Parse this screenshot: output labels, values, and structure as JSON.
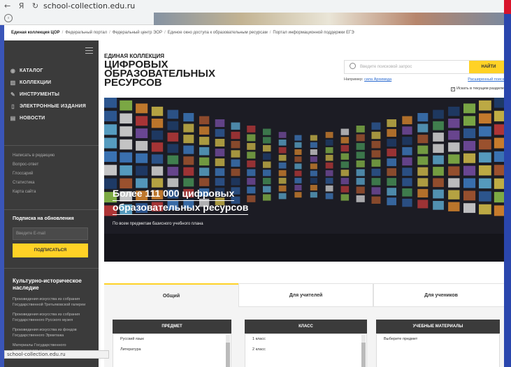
{
  "browser": {
    "url": "school-collection.edu.ru",
    "status_url": "school-collection.edu.ru"
  },
  "breadcrumb": [
    "Единая коллекция ЦОР",
    "Федеральный портал",
    "Федеральный центр ЭОР",
    "Единое окно доступа к образовательным ресурсам",
    "Портал информационной поддержки ЕГЭ"
  ],
  "sidebar": {
    "menu": [
      {
        "label": "КАТАЛОГ",
        "icon": "catalog-icon"
      },
      {
        "label": "КОЛЛЕКЦИИ",
        "icon": "collections-icon"
      },
      {
        "label": "ИНСТРУМЕНТЫ",
        "icon": "tools-icon"
      },
      {
        "label": "ЭЛЕКТРОННЫЕ ИЗДАНИЯ",
        "icon": "tablet-icon"
      },
      {
        "label": "НОВОСТИ",
        "icon": "news-icon"
      }
    ],
    "links": [
      "Написать в редакцию",
      "Вопрос-ответ",
      "Глоссарий",
      "Статистика",
      "Карта сайта"
    ],
    "subscribe": {
      "title": "Подписка на обновления",
      "email_placeholder": "Введите E-mail",
      "button": "ПОДПИСАТЬСЯ"
    },
    "heritage": {
      "title": "Культурно-историческое наследие",
      "items": [
        "Произведения искусства из собрания Государственной Третьяковской галереи",
        "Произведения искусства из собрания Государственного Русского музея",
        "Произведения искусства из фондов Государственного Эрмитажа",
        "Материалы Государственного исторического музея"
      ]
    }
  },
  "header": {
    "logo_small": "ЕДИНАЯ КОЛЛЕКЦИЯ",
    "logo_big": "ЦИФРОВЫХ ОБРАЗОВАТЕЛЬНЫХ РЕСУРСОВ",
    "search_placeholder": "Введите поисковой запрос",
    "search_button": "НАЙТИ",
    "example_prefix": "Например:",
    "example_link": "сила Архимеда",
    "advanced_search": "Расширенный поиск",
    "search_in_section": "Искать в текущем разделе"
  },
  "hero": {
    "title_line1": "Более 111 000 цифровых",
    "title_line2": "образовательных ресурсов",
    "subtitle": "По всем предметам базисного учебного плана"
  },
  "tabs": [
    "Общий",
    "Для учителей",
    "Для учеников"
  ],
  "filters": {
    "subject": {
      "header": "ПРЕДМЕТ",
      "options": [
        "Русский язык",
        "Литература"
      ]
    },
    "grade": {
      "header": "КЛАСС",
      "options": [
        "1 класс",
        "2 класс"
      ]
    },
    "materials": {
      "header": "УЧЕБНЫЕ МАТЕРИАЛЫ",
      "options": [
        "Выберите предмет"
      ]
    }
  },
  "colors": {
    "accent": "#ffd226",
    "sidebar": "#3b3b3b",
    "link": "#2a6ad0"
  }
}
